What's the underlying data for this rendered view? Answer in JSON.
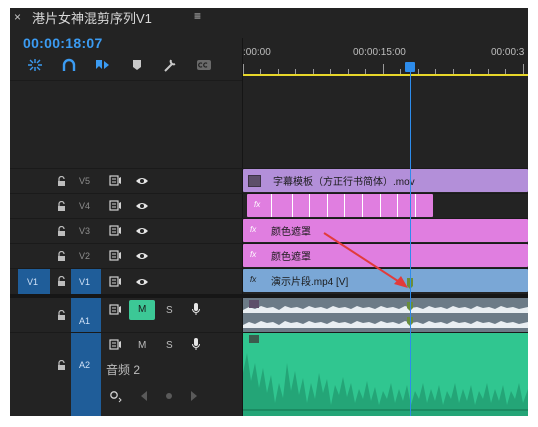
{
  "header": {
    "close_glyph": "×",
    "title": "港片女神混剪序列V1",
    "menu_glyph": "≡"
  },
  "timecode": "00:00:18:07",
  "toolbar": {
    "icons": [
      "snap-icon",
      "magnet-link-icon",
      "marker-add-icon",
      "marker-icon",
      "wrench-icon",
      "captions-icon"
    ]
  },
  "ruler": {
    "labels": [
      ":00:00",
      "00:00:15:00",
      "00:00:3"
    ]
  },
  "tracks": {
    "video": [
      {
        "name": "V5"
      },
      {
        "name": "V4"
      },
      {
        "name": "V3"
      },
      {
        "name": "V2"
      },
      {
        "name": "V1",
        "source_patch": "V1"
      }
    ],
    "audio": [
      {
        "name": "A1",
        "mute": "M",
        "solo": "S"
      },
      {
        "name": "A2",
        "mute": "M",
        "solo": "S",
        "label": "音频 2"
      }
    ]
  },
  "clips": {
    "v5": {
      "name": "字幕模板（方正行书简体）.mov",
      "color": "#b38fd9"
    },
    "v4": {
      "fx": "fx",
      "color": "#e07ee0"
    },
    "v3": {
      "fx": "fx",
      "name": "颜色遮罩",
      "color": "#e07ee0"
    },
    "v2": {
      "fx": "fx",
      "name": "颜色遮罩",
      "color": "#e07ee0"
    },
    "v1": {
      "fx": "fx",
      "name": "演示片段.mp4 [V]",
      "color": "#7aa7d6"
    }
  },
  "colors": {
    "accent": "#3b9bf2",
    "work_area": "#e7d62a",
    "mute_active": "#3cc896",
    "audio_clip": "#2fc48e",
    "annotation_arrow": "#e23b3b"
  }
}
